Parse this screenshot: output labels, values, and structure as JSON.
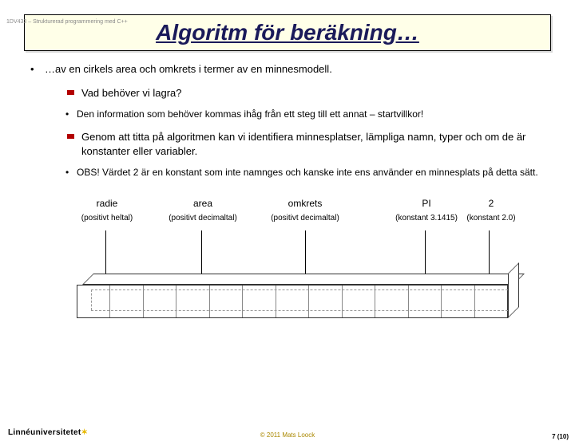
{
  "course_code": "1DV433 – Strukturerad programmering med C++",
  "title": "Algoritm för beräkning…",
  "b1": "…av en cirkels area och omkrets i termer av en minnesmodell.",
  "s1a": "Vad behöver vi lagra?",
  "s1a_i": "Den information som behöver kommas ihåg från ett steg till ett annat – startvillkor!",
  "s1b": "Genom att titta på algoritmen kan vi identifiera minnesplatser, lämpliga namn, typer och om de är konstanter eller variabler.",
  "s1b_i": "OBS! Värdet 2 är en konstant som inte namnges och kanske inte ens använder en minnesplats på detta sätt.",
  "labels": {
    "radie": {
      "name": "radie",
      "desc": "(positivt heltal)"
    },
    "area": {
      "name": "area",
      "desc": "(positivt decimaltal)"
    },
    "omkrets": {
      "name": "omkrets",
      "desc": "(positivt decimaltal)"
    },
    "pi": {
      "name": "PI",
      "desc": "(konstant 3.1415)"
    },
    "two": {
      "name": "2",
      "desc": "(konstant 2.0)"
    }
  },
  "footer": {
    "university": "Linnéuniversitetet",
    "copyright": "© 2011 Mats Loock",
    "page": "7 (10)"
  }
}
